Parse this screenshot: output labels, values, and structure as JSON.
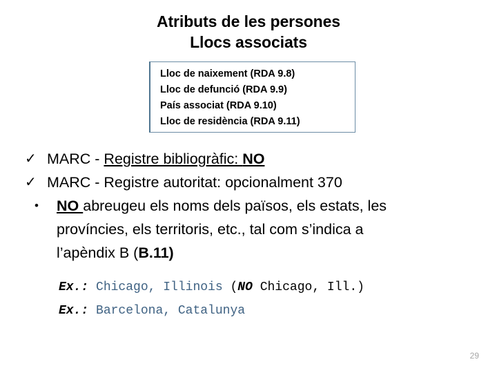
{
  "slide": {
    "title": {
      "line1": "Atributs de les persones",
      "line2": "Llocs associats"
    },
    "box": {
      "border_color": "#6b8ca5",
      "items": [
        "Lloc de naixement (RDA 9.8)",
        "Lloc de defunció (RDA 9.9)",
        "País associat (RDA 9.10)",
        "Lloc de residència (RDA 9.11)"
      ]
    },
    "bullets": [
      {
        "marker": "✓",
        "marker_icon": "check-icon",
        "prefix": "MARC - ",
        "underlined": "Registre bibliogràfic: ",
        "underlined_bold": "NO",
        "suffix": ""
      },
      {
        "marker": "✓",
        "marker_icon": "check-icon",
        "prefix": "MARC - Registre autoritat: opcionalment 370",
        "underlined": "",
        "underlined_bold": "",
        "suffix": ""
      },
      {
        "marker": "•",
        "marker_icon": "dot-bullet-icon",
        "prefix": "",
        "underlined": "",
        "underlined_bold": "NO ",
        "suffix": "abreugeu els noms dels països, els estats, les"
      }
    ],
    "continuation": {
      "line1": "províncies, els territoris, etc., tal com s’indica a",
      "line2_plain": "l’apèndix B (",
      "line2_bold": "B.11)"
    },
    "examples": [
      {
        "label": "Ex.:",
        "blue_text": "Chicago, Illinois",
        "black_open": "(",
        "no_text": "NO",
        "black_rest": " Chicago, Ill.)",
        "blue_color": "#3f6283"
      },
      {
        "label": "Ex.:",
        "blue_text": "Barcelona, Catalunya",
        "black_open": "",
        "no_text": "",
        "black_rest": "",
        "blue_color": "#3f6283"
      }
    ],
    "page_number": "29"
  }
}
